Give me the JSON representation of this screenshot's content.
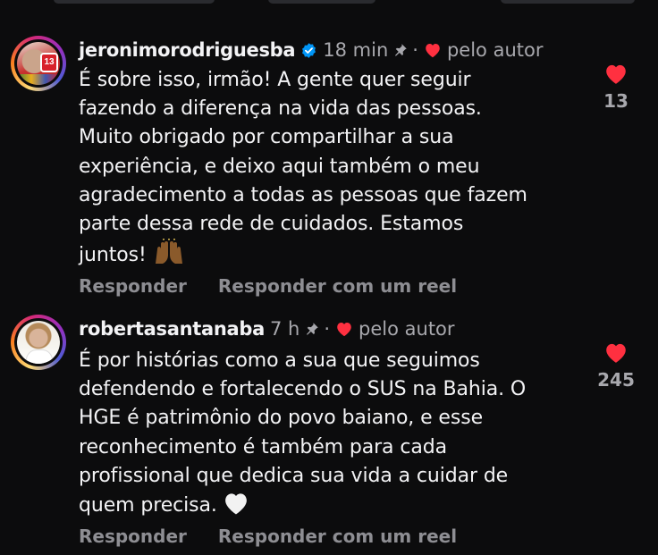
{
  "comments": [
    {
      "username": "jeronimorodriguesba",
      "verified": true,
      "time": "18 min",
      "by_author": "pelo autor",
      "text": "É sobre isso, irmão! A gente quer seguir\nfazendo a diferença na vida das pessoas.\nMuito obrigado por compartilhar a sua\nexperiência, e deixo aqui também o meu\nagradecimento a todas as pessoas que fazem\nparte dessa rede de cuidados. Estamos\njuntos!",
      "emoji": "raising-hands",
      "likes": "13",
      "reply_label": "Responder",
      "reel_reply_label": "Responder com um reel"
    },
    {
      "username": "robertasantanaba",
      "verified": false,
      "time": "7 h",
      "by_author": "pelo autor",
      "text": "É por histórias como a sua que seguimos\ndefendendo e fortalecendo o SUS na Bahia. O\nHGE é patrimônio do povo baiano, e esse\nreconhecimento é também para cada\nprofissional que dedica sua vida a cuidar de\nquem precisa.",
      "emoji": "white-heart",
      "likes": "245",
      "reply_label": "Responder",
      "reel_reply_label": "Responder com um reel"
    }
  ],
  "colors": {
    "background": "#0c0c0d",
    "text": "#f3f3f5",
    "muted": "#a8a8ad",
    "like_red": "#ff3040",
    "verified_blue": "#0095f6"
  }
}
